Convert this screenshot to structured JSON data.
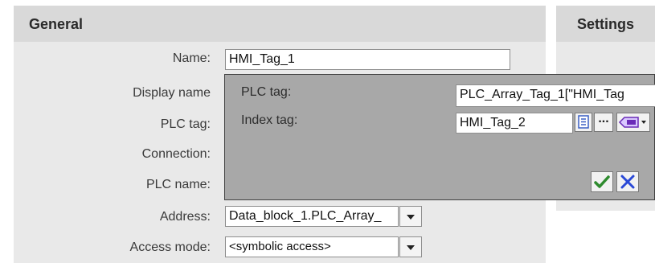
{
  "general": {
    "title": "General",
    "fields": {
      "name_label": "Name:",
      "name_value": "HMI_Tag_1",
      "display_name_label": "Display name",
      "plc_tag_label": "PLC tag:",
      "connection_label": "Connection:",
      "plc_name_label": "PLC name:",
      "address_label": "Address:",
      "address_value": "Data_block_1.PLC_Array_",
      "access_mode_label": "Access mode:",
      "access_mode_value": "<symbolic access>"
    }
  },
  "settings": {
    "title": "Settings"
  },
  "popup": {
    "plc_tag_label": "PLC tag:",
    "plc_tag_value": "PLC_Array_Tag_1[\"HMI_Tag",
    "index_tag_label": "Index tag:",
    "index_tag_value": "HMI_Tag_2",
    "browse_label": "...",
    "icons": [
      "list-icon",
      "tag-dropdown-icon",
      "check-icon",
      "close-icon"
    ],
    "accent_colors": {
      "confirm": "#2e8b2e",
      "cancel": "#2a49d6"
    }
  }
}
